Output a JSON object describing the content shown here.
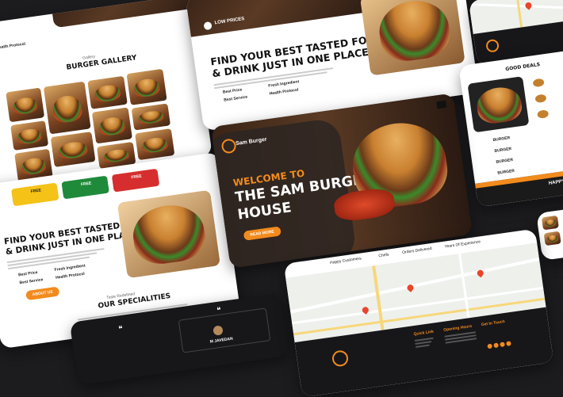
{
  "hero": {
    "brand": "Sam Burger",
    "welcome": "WELCOME TO",
    "title_line1": "THE SAM BURGER",
    "title_line2": "HOUSE",
    "cta": "READ MORE"
  },
  "stats": {
    "items": [
      "Happy Customers",
      "Chefs",
      "Orders Delivered",
      "Years Of Experience"
    ]
  },
  "gallery": {
    "eyebrow": "Gallery",
    "title": "BURGER GALLERY",
    "top_fragment": "Health Protocol"
  },
  "tagline": {
    "line1": "FIND YOUR BEST TASTED FOOD",
    "line2": "& DRINK JUST IN ONE PLACE",
    "features": [
      "Best Price",
      "Fresh Ingredient",
      "Best Service",
      "Health Protocol"
    ],
    "top_fragment": "LOW PRICES"
  },
  "specialities": {
    "eyebrow": "Taste Redefined",
    "title": "OUR SPECIALITIES",
    "cta": "ABOUT US",
    "promo": [
      "FREE",
      "FREE",
      "FREE"
    ]
  },
  "deals": {
    "title": "GOOD DEALS",
    "items": [
      "BURGER",
      "BURGER",
      "BURGER",
      "BURGER"
    ],
    "banner": "HAPPY CUS"
  },
  "footer": {
    "quick_links": "Quick Link",
    "opening_hours": "Opening Hours",
    "get_in_touch": "Get In Touch",
    "testimonial_name": "M JAVEDAN"
  },
  "colors": {
    "accent": "#f28b1e",
    "dark": "#17171a",
    "promo_yellow": "#f5c218",
    "promo_green": "#1f8a3a",
    "promo_red": "#d62e2e"
  }
}
